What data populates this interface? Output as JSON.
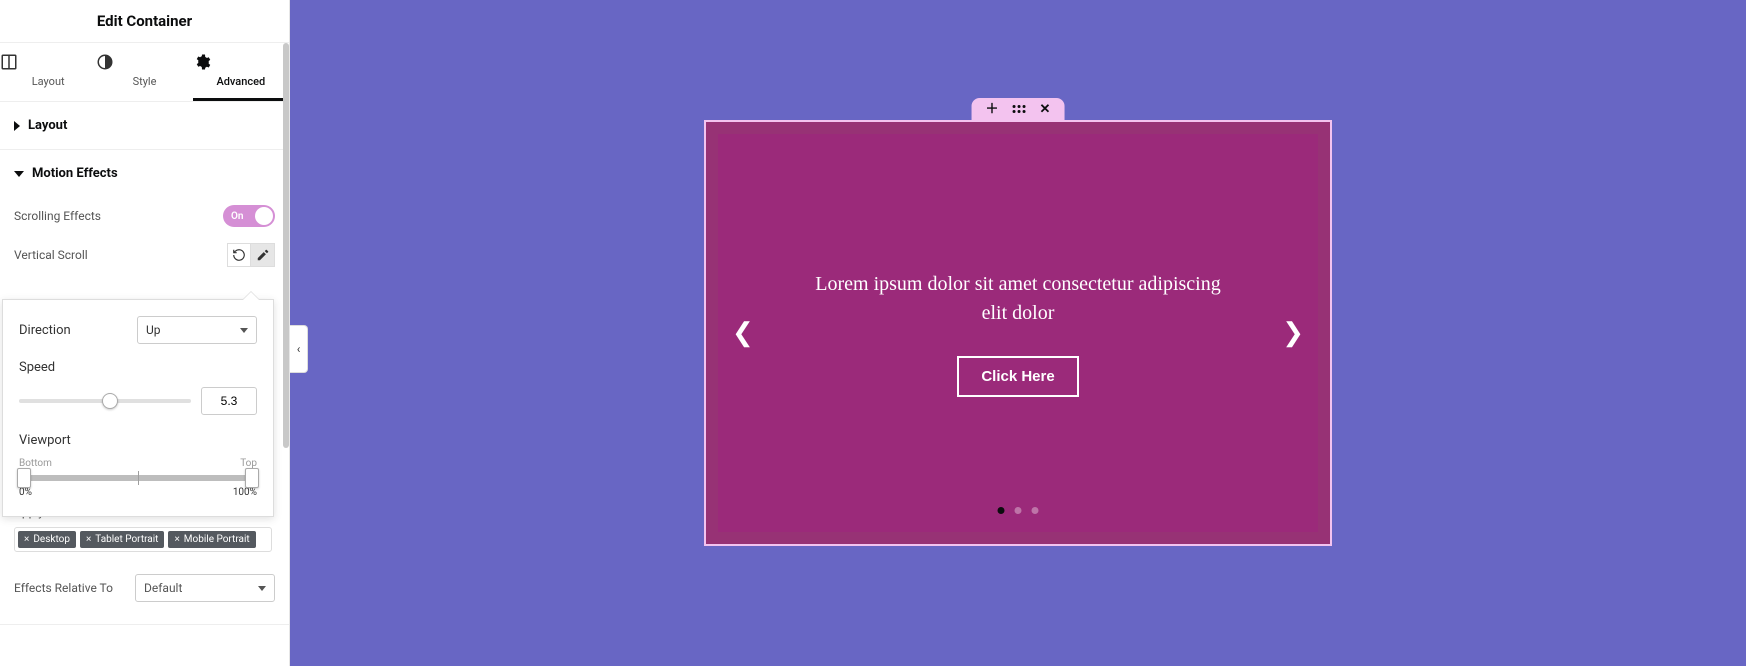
{
  "panel": {
    "title": "Edit Container",
    "tabs": {
      "layout": "Layout",
      "style": "Style",
      "advanced": "Advanced",
      "active": "advanced"
    },
    "sections": {
      "layout_label": "Layout",
      "motion_label": "Motion Effects"
    },
    "scrolling_effects": {
      "label": "Scrolling Effects",
      "value_label": "On"
    },
    "vertical_scroll": {
      "label": "Vertical Scroll"
    },
    "popover": {
      "direction_label": "Direction",
      "direction_value": "Up",
      "speed_label": "Speed",
      "speed_value": "5.3",
      "speed_pct": 53,
      "viewport_label": "Viewport",
      "viewport_top_label": "Top",
      "viewport_bottom_label": "Bottom",
      "viewport_min": "0%",
      "viewport_max": "100%"
    },
    "apply_on": {
      "label": "Apply Effects On",
      "tags": [
        "Desktop",
        "Tablet Portrait",
        "Mobile Portrait"
      ]
    },
    "relative": {
      "label": "Effects Relative To",
      "value": "Default"
    }
  },
  "canvas": {
    "slide_text": "Lorem ipsum dolor sit amet consectetur adipiscing elit dolor",
    "button_label": "Click Here"
  }
}
